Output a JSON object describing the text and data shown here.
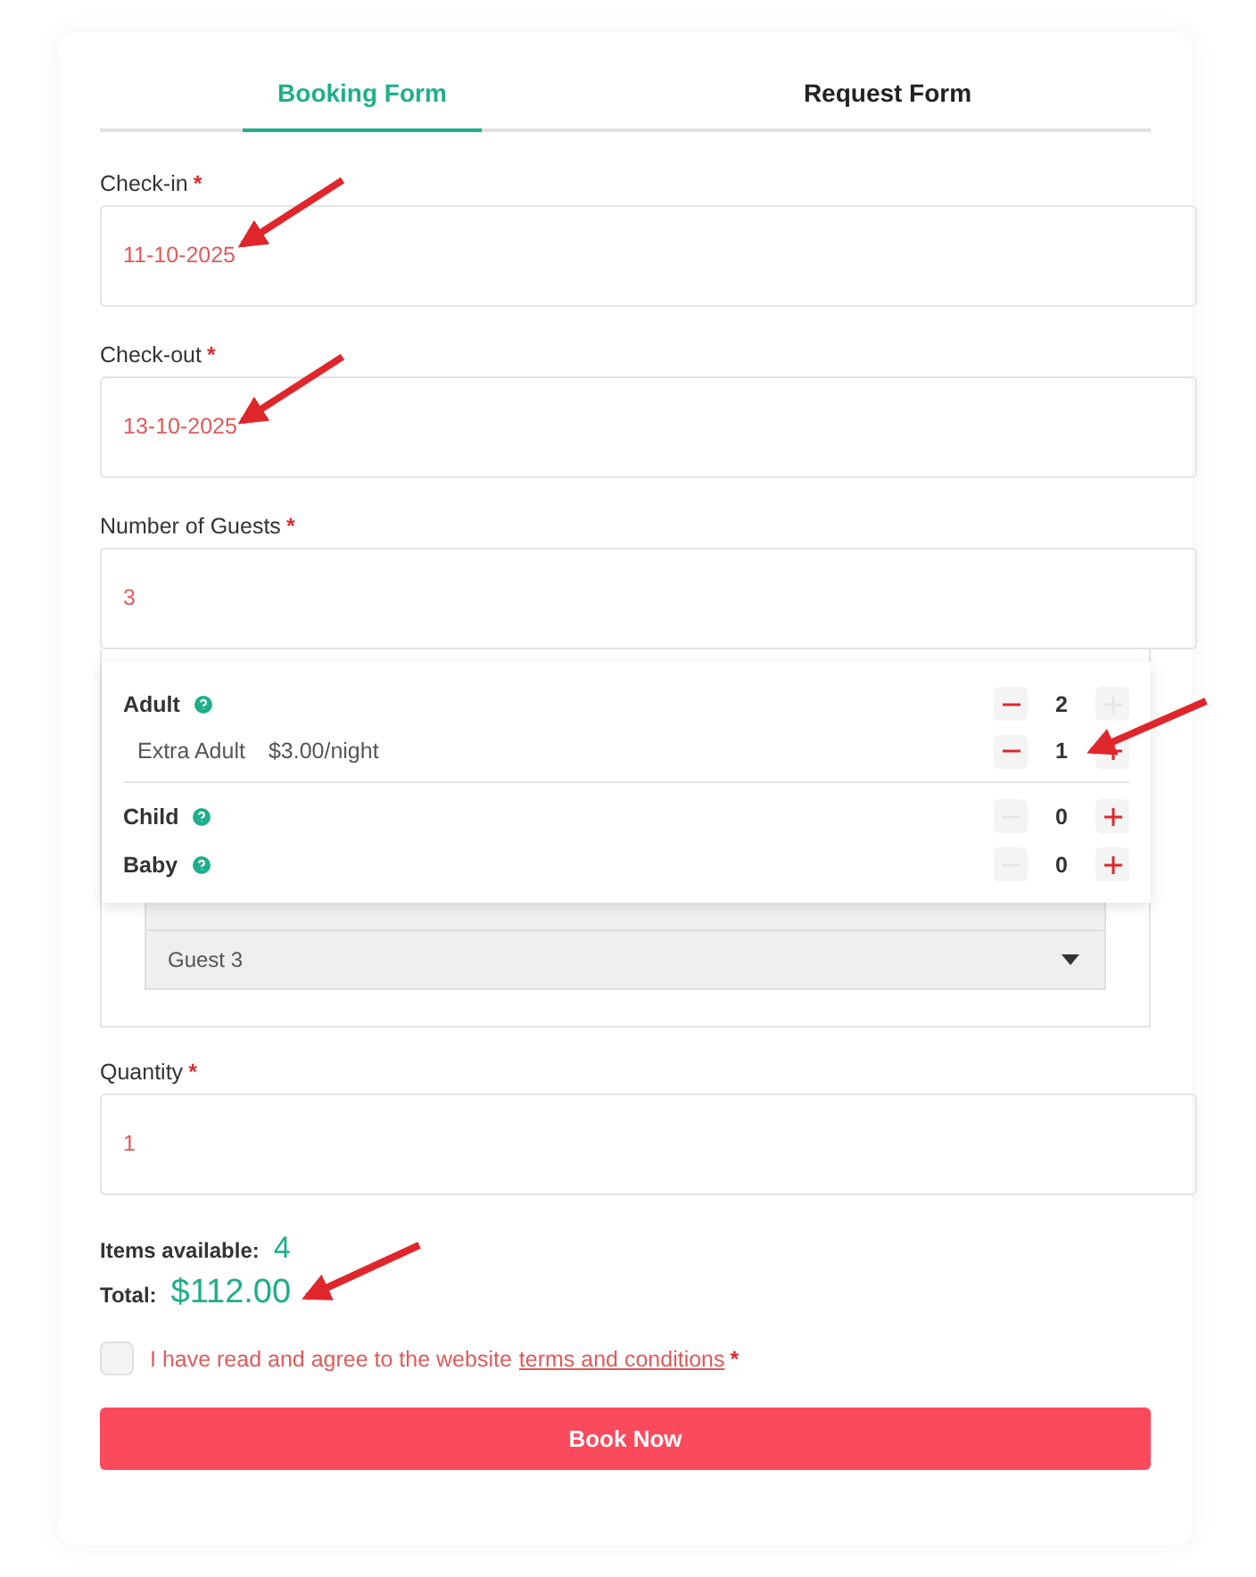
{
  "tabs": [
    {
      "label": "Booking Form",
      "selected": true
    },
    {
      "label": "Request Form",
      "selected": false
    }
  ],
  "fields": [
    {
      "label": "Check-in",
      "required": "*",
      "value": "11-10-2025"
    },
    {
      "label": "Check-out",
      "required": "*",
      "value": "13-10-2025"
    },
    {
      "label": "Number of Guests",
      "required": "*",
      "value": "3"
    }
  ],
  "guest_picker": {
    "rows": [
      {
        "kind": "main",
        "label": "Adult",
        "value": "2",
        "minus_disabled": false,
        "plus_disabled": true
      },
      {
        "kind": "extra",
        "label": "Extra Adult",
        "price": "$3.00/night",
        "value": "1",
        "minus_disabled": false,
        "plus_disabled": false
      },
      {
        "kind": "main",
        "label": "Child",
        "value": "0",
        "minus_disabled": true,
        "plus_disabled": false
      },
      {
        "kind": "main",
        "label": "Baby",
        "value": "0",
        "minus_disabled": true,
        "plus_disabled": false
      }
    ],
    "guest_select": "Guest 3"
  },
  "quantity": {
    "label": "Quantity",
    "required": "*",
    "value": "1"
  },
  "items_available": {
    "label": "Items available:",
    "value": "4"
  },
  "total": {
    "label": "Total:",
    "value": "$112.00"
  },
  "agreement": {
    "checked": false,
    "text": "I have read and agree to the website",
    "link": "terms and conditions",
    "required": "*"
  },
  "submit": "Book Now"
}
